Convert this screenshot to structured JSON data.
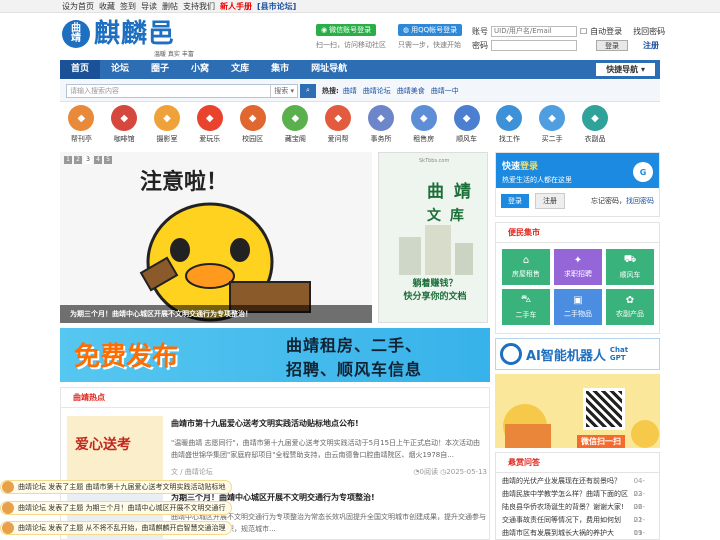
{
  "topbar": {
    "links": [
      "设为首页",
      "收藏",
      "签到",
      "导读",
      "删帖",
      "支持我们"
    ],
    "new_user": "新人手册",
    "county": "[县市论坛]"
  },
  "header": {
    "logo_small": [
      "曲",
      "靖"
    ],
    "logo_big": "麒麟邑",
    "slogan": "温暖 真实 丰富",
    "wechat_btn": "微信账号登录",
    "wechat_note": "扫一扫，访问移动社区",
    "qq_btn": "用QQ帐号登录",
    "qq_note": "只需一步，快速开始",
    "account_label": "账号",
    "account_placeholder": "UID/用户名/Email",
    "auto_login": "自动登录",
    "forgot": "找回密码",
    "password_label": "密码",
    "login_btn": "登录",
    "register": "注册"
  },
  "nav": {
    "items": [
      "首页",
      "论坛",
      "圈子",
      "小窝",
      "文库",
      "集市",
      "网址导航"
    ],
    "quick": "快捷导航"
  },
  "search": {
    "placeholder": "请输入搜索内容",
    "select": "搜索",
    "hot_label": "热搜:",
    "keywords": [
      "曲靖",
      "曲靖论坛",
      "曲靖美食",
      "曲靖一中"
    ]
  },
  "quick_icons": [
    {
      "label": "帮刊亭",
      "color": "#e98a3a"
    },
    {
      "label": "咖啡馆",
      "color": "#d6473d"
    },
    {
      "label": "摄影室",
      "color": "#f0a23a"
    },
    {
      "label": "爱玩乐",
      "color": "#e9422d"
    },
    {
      "label": "校园区",
      "color": "#e0672f"
    },
    {
      "label": "藏宝阁",
      "color": "#5ab04c"
    },
    {
      "label": "爱问帮",
      "color": "#e25b3e"
    },
    {
      "label": "事务所",
      "color": "#6d85c9"
    },
    {
      "label": "租售房",
      "color": "#5e8fd6"
    },
    {
      "label": "顺风车",
      "color": "#4c7fcf"
    },
    {
      "label": "找工作",
      "color": "#3d91d8"
    },
    {
      "label": "买二手",
      "color": "#4e9ee0"
    },
    {
      "label": "衣副品",
      "color": "#2fa39a"
    }
  ],
  "slider": {
    "pages": [
      "1",
      "2",
      "3",
      "4",
      "5"
    ],
    "active": "3",
    "image_text": "注意啦！",
    "caption": "为期三个月！曲靖中心城区开展不文明交通行为专项整治！"
  },
  "ad_book": {
    "tiny": "SkTbbs.com",
    "title1": "曲 靖",
    "title2": "文 库",
    "bottom1": "躺着赚钱？",
    "bottom2": "快分享你的文档"
  },
  "banner": {
    "left": "免费发布",
    "right1": "曲靖租房、二手、",
    "right2": "招聘、顺风车信息"
  },
  "hot": {
    "title": "曲靖热点",
    "articles": [
      {
        "title": "曲靖市第十九届爱心送考文明实践活动贴标地点公布!",
        "desc": "\"温暖曲靖 志愿同行\"，曲靖市第十九届爱心送考文明实践活动于5月15日上午正式启动！本次活动由曲靖盛世锦华集团\"家庭府邸项目\"全程赞助支持，由云南德鲁口腔曲靖院区、烟火1978自...",
        "author": "文 / 曲靖论坛",
        "views": "0阅读",
        "date": "2025-05-13",
        "thumb_text": "爱心送考"
      },
      {
        "title": "为期三个月！曲靖中心城区开展不文明交通行为专项整治!",
        "desc": "曲靖中心城区开展不文明交通行为专项整治为常态长效巩固提升全国文明城市创建成果，提升交通参与者安全文明出行意识，规范城市...",
        "author": "",
        "views": "",
        "date": "",
        "thumb_text": ""
      }
    ]
  },
  "fast_login": {
    "title_prefix": "快速",
    "title_em": "登录",
    "sub": "热爱生活的人都在这里",
    "badge": "G",
    "login": "登录",
    "register": "注册",
    "forgot_prefix": "忘记密码，",
    "forgot_link": "找回密码"
  },
  "service": {
    "title": "便民集市",
    "items": [
      {
        "label": "房屋租售",
        "icon": "⌂",
        "color": "#3ab27b"
      },
      {
        "label": "求职招聘",
        "icon": "✦",
        "color": "#9566d8"
      },
      {
        "label": "顺风车",
        "icon": "⛟",
        "color": "#3ab27b"
      },
      {
        "label": "二手车",
        "icon": "⛍",
        "color": "#3ab27b"
      },
      {
        "label": "二手物品",
        "icon": "▣",
        "color": "#4b8de0"
      },
      {
        "label": "农副产品",
        "icon": "✿",
        "color": "#3ab27b"
      }
    ]
  },
  "ai": {
    "text": "AI智能机器人",
    "chat": "Chat",
    "gpt": "GPT"
  },
  "wechat_ad": {
    "label": "微信扫一扫"
  },
  "qa": {
    "title": "悬赏问答",
    "rows": [
      {
        "q": "曲靖的光伏产业发展现在还有前景吗？",
        "d": "04-23"
      },
      {
        "q": "曲靖民族中学教学怎么样？曲靖下面的区",
        "d": "02-26"
      },
      {
        "q": "陆良县华侨农场诞生的背景？谢谢大家!",
        "d": "02-21"
      },
      {
        "q": "交通事故责任同等情况下，费用如何划",
        "d": "02-19"
      },
      {
        "q": "曲靖市区有发展到城长大祸的养护大",
        "d": "01-06"
      }
    ]
  },
  "toasts": [
    "曲靖论坛 发表了主题 曲靖市第十九届爱心送考文明实践活动贴标地",
    "曲靖论坛 发表了主题 为期三个月！曲靖中心城区开展不文明交通行",
    "曲靖论坛 发表了主题 从不将不乱开始，曲靖麒麟开启智慧交通治理"
  ]
}
